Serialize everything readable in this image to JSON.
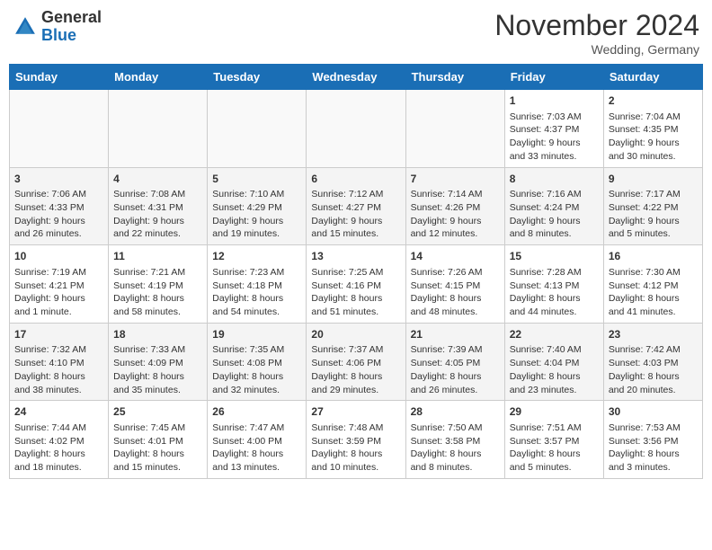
{
  "header": {
    "logo_general": "General",
    "logo_blue": "Blue",
    "month_title": "November 2024",
    "subtitle": "Wedding, Germany"
  },
  "days_of_week": [
    "Sunday",
    "Monday",
    "Tuesday",
    "Wednesday",
    "Thursday",
    "Friday",
    "Saturday"
  ],
  "weeks": [
    [
      {
        "day": "",
        "content": ""
      },
      {
        "day": "",
        "content": ""
      },
      {
        "day": "",
        "content": ""
      },
      {
        "day": "",
        "content": ""
      },
      {
        "day": "",
        "content": ""
      },
      {
        "day": "1",
        "content": "Sunrise: 7:03 AM\nSunset: 4:37 PM\nDaylight: 9 hours and 33 minutes."
      },
      {
        "day": "2",
        "content": "Sunrise: 7:04 AM\nSunset: 4:35 PM\nDaylight: 9 hours and 30 minutes."
      }
    ],
    [
      {
        "day": "3",
        "content": "Sunrise: 7:06 AM\nSunset: 4:33 PM\nDaylight: 9 hours and 26 minutes."
      },
      {
        "day": "4",
        "content": "Sunrise: 7:08 AM\nSunset: 4:31 PM\nDaylight: 9 hours and 22 minutes."
      },
      {
        "day": "5",
        "content": "Sunrise: 7:10 AM\nSunset: 4:29 PM\nDaylight: 9 hours and 19 minutes."
      },
      {
        "day": "6",
        "content": "Sunrise: 7:12 AM\nSunset: 4:27 PM\nDaylight: 9 hours and 15 minutes."
      },
      {
        "day": "7",
        "content": "Sunrise: 7:14 AM\nSunset: 4:26 PM\nDaylight: 9 hours and 12 minutes."
      },
      {
        "day": "8",
        "content": "Sunrise: 7:16 AM\nSunset: 4:24 PM\nDaylight: 9 hours and 8 minutes."
      },
      {
        "day": "9",
        "content": "Sunrise: 7:17 AM\nSunset: 4:22 PM\nDaylight: 9 hours and 5 minutes."
      }
    ],
    [
      {
        "day": "10",
        "content": "Sunrise: 7:19 AM\nSunset: 4:21 PM\nDaylight: 9 hours and 1 minute."
      },
      {
        "day": "11",
        "content": "Sunrise: 7:21 AM\nSunset: 4:19 PM\nDaylight: 8 hours and 58 minutes."
      },
      {
        "day": "12",
        "content": "Sunrise: 7:23 AM\nSunset: 4:18 PM\nDaylight: 8 hours and 54 minutes."
      },
      {
        "day": "13",
        "content": "Sunrise: 7:25 AM\nSunset: 4:16 PM\nDaylight: 8 hours and 51 minutes."
      },
      {
        "day": "14",
        "content": "Sunrise: 7:26 AM\nSunset: 4:15 PM\nDaylight: 8 hours and 48 minutes."
      },
      {
        "day": "15",
        "content": "Sunrise: 7:28 AM\nSunset: 4:13 PM\nDaylight: 8 hours and 44 minutes."
      },
      {
        "day": "16",
        "content": "Sunrise: 7:30 AM\nSunset: 4:12 PM\nDaylight: 8 hours and 41 minutes."
      }
    ],
    [
      {
        "day": "17",
        "content": "Sunrise: 7:32 AM\nSunset: 4:10 PM\nDaylight: 8 hours and 38 minutes."
      },
      {
        "day": "18",
        "content": "Sunrise: 7:33 AM\nSunset: 4:09 PM\nDaylight: 8 hours and 35 minutes."
      },
      {
        "day": "19",
        "content": "Sunrise: 7:35 AM\nSunset: 4:08 PM\nDaylight: 8 hours and 32 minutes."
      },
      {
        "day": "20",
        "content": "Sunrise: 7:37 AM\nSunset: 4:06 PM\nDaylight: 8 hours and 29 minutes."
      },
      {
        "day": "21",
        "content": "Sunrise: 7:39 AM\nSunset: 4:05 PM\nDaylight: 8 hours and 26 minutes."
      },
      {
        "day": "22",
        "content": "Sunrise: 7:40 AM\nSunset: 4:04 PM\nDaylight: 8 hours and 23 minutes."
      },
      {
        "day": "23",
        "content": "Sunrise: 7:42 AM\nSunset: 4:03 PM\nDaylight: 8 hours and 20 minutes."
      }
    ],
    [
      {
        "day": "24",
        "content": "Sunrise: 7:44 AM\nSunset: 4:02 PM\nDaylight: 8 hours and 18 minutes."
      },
      {
        "day": "25",
        "content": "Sunrise: 7:45 AM\nSunset: 4:01 PM\nDaylight: 8 hours and 15 minutes."
      },
      {
        "day": "26",
        "content": "Sunrise: 7:47 AM\nSunset: 4:00 PM\nDaylight: 8 hours and 13 minutes."
      },
      {
        "day": "27",
        "content": "Sunrise: 7:48 AM\nSunset: 3:59 PM\nDaylight: 8 hours and 10 minutes."
      },
      {
        "day": "28",
        "content": "Sunrise: 7:50 AM\nSunset: 3:58 PM\nDaylight: 8 hours and 8 minutes."
      },
      {
        "day": "29",
        "content": "Sunrise: 7:51 AM\nSunset: 3:57 PM\nDaylight: 8 hours and 5 minutes."
      },
      {
        "day": "30",
        "content": "Sunrise: 7:53 AM\nSunset: 3:56 PM\nDaylight: 8 hours and 3 minutes."
      }
    ]
  ]
}
